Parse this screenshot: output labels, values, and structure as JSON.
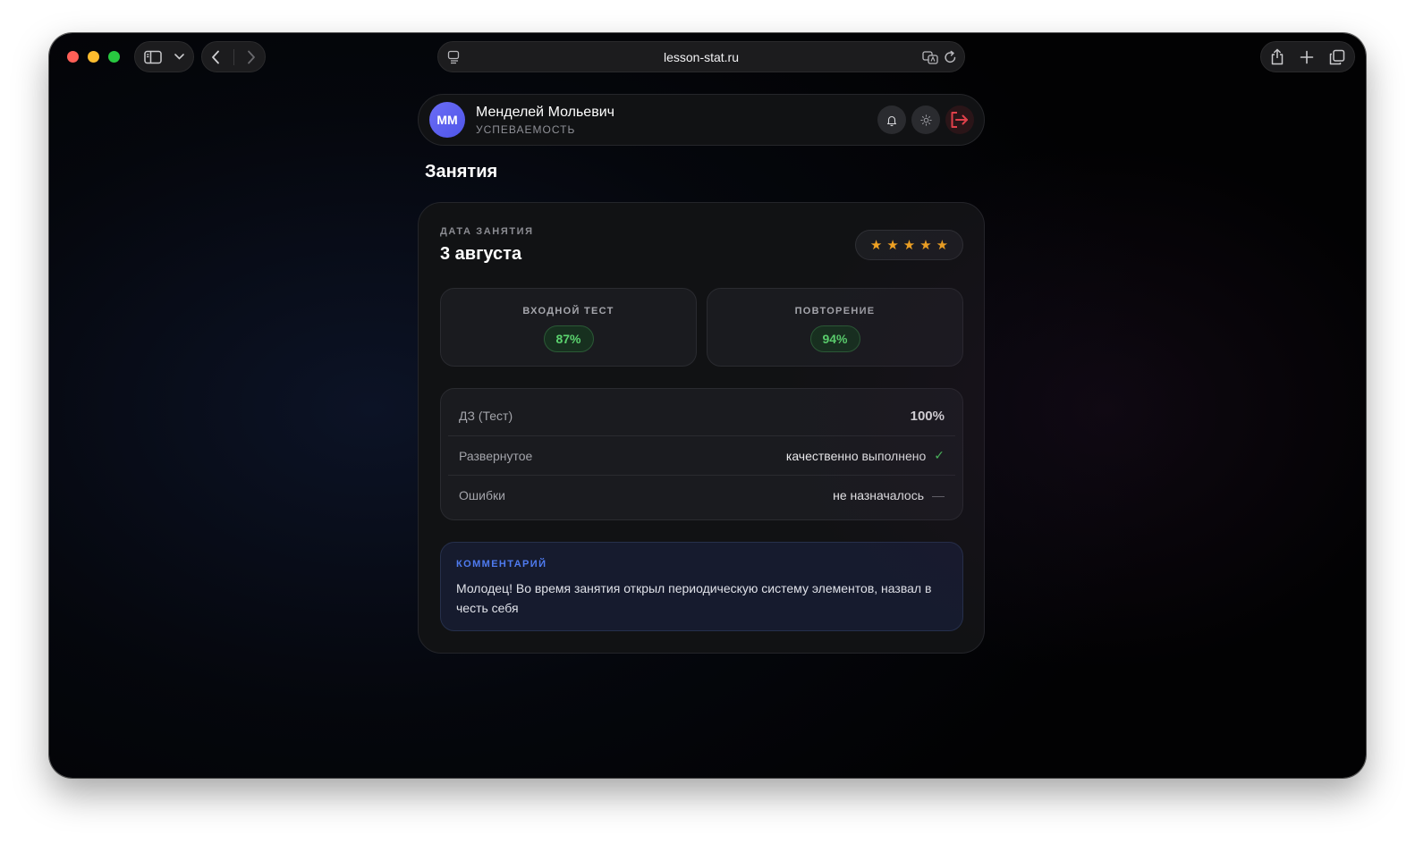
{
  "browser": {
    "address": "lesson-stat.ru",
    "icons": [
      "sidebar-icon",
      "chevron-down-icon",
      "back-icon",
      "forward-icon",
      "reader-icon",
      "translate-icon",
      "reload-icon",
      "share-icon",
      "new-tab-icon",
      "tabs-icon"
    ]
  },
  "profile": {
    "initials": "ММ",
    "name": "Менделей Мольевич",
    "subtitle": "УСПЕВАЕМОСТЬ",
    "avatar_color": "#5a5ff0",
    "logout_color": "#e0404a"
  },
  "page": {
    "title": "Занятия"
  },
  "lesson": {
    "date_label": "ДАТА ЗАНЯТИЯ",
    "date": "3 августа",
    "rating": 5,
    "rating_max": 5,
    "star_color": "#f5a623",
    "metrics": [
      {
        "label": "ВХОДНОЙ ТЕСТ",
        "value": "87%"
      },
      {
        "label": "ПОВТОРЕНИЕ",
        "value": "94%"
      }
    ],
    "details": [
      {
        "label": "ДЗ (Тест)",
        "value": "100%"
      },
      {
        "label": "Развернутое",
        "value": "качественно выполнено",
        "status": "done"
      },
      {
        "label": "Ошибки",
        "value": "не назначалось",
        "status": "none"
      }
    ],
    "comment_label": "КОММЕНТАРИЙ",
    "comment": "Молодец! Во время занятия открыл периодическую систему элементов, назвал в честь себя"
  },
  "colors": {
    "success": "#5bd36e",
    "accent": "#4f7bf0"
  }
}
